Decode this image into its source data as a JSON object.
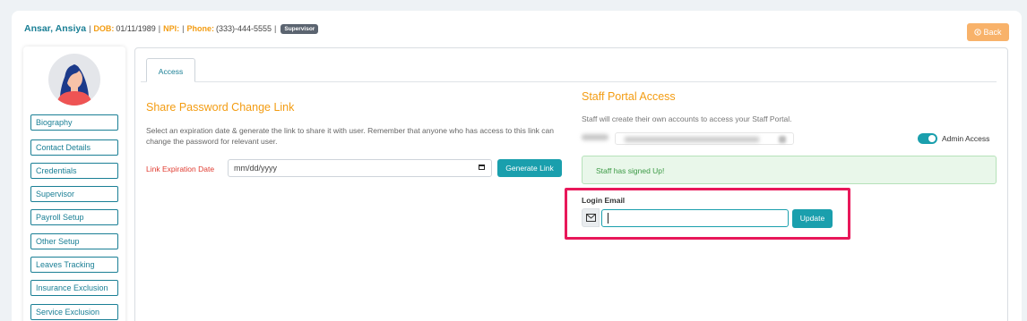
{
  "patient": {
    "name": "Ansar, Ansiya",
    "dob_label": "DOB:",
    "dob": "01/11/1989",
    "npi_label": "NPI:",
    "phone_label": "Phone:",
    "phone": "(333)-444-5555",
    "badge": "Supervisor"
  },
  "back_label": "Back",
  "sidebar": {
    "items": [
      {
        "label": "Biography"
      },
      {
        "label": "Contact Details"
      },
      {
        "label": "Credentials"
      },
      {
        "label": "Supervisor"
      },
      {
        "label": "Payroll Setup"
      },
      {
        "label": "Other Setup"
      },
      {
        "label": "Leaves Tracking"
      },
      {
        "label": "Insurance Exclusion"
      },
      {
        "label": "Service Exclusion"
      }
    ]
  },
  "tabs": [
    {
      "label": "Access"
    }
  ],
  "share": {
    "title": "Share Password Change Link",
    "description": "Select an expiration date & generate the link to share it with user. Remember that anyone who has access to this link can change the password for relevant user.",
    "expiration_label": "Link Expiration Date",
    "date_placeholder": "mm/dd/yyyy",
    "generate_label": "Generate Link"
  },
  "portal": {
    "title": "Staff Portal Access",
    "description": "Staff will create their own accounts to access your Staff Portal.",
    "admin_access_label": "Admin Access",
    "admin_access_on": true,
    "signed_up_message": "Staff has signed Up!",
    "login_email_label": "Login Email",
    "login_email_value": "",
    "update_label": "Update"
  },
  "colors": {
    "teal": "#1a9fad",
    "orange": "#f39c12",
    "highlight": "#e8185a"
  }
}
